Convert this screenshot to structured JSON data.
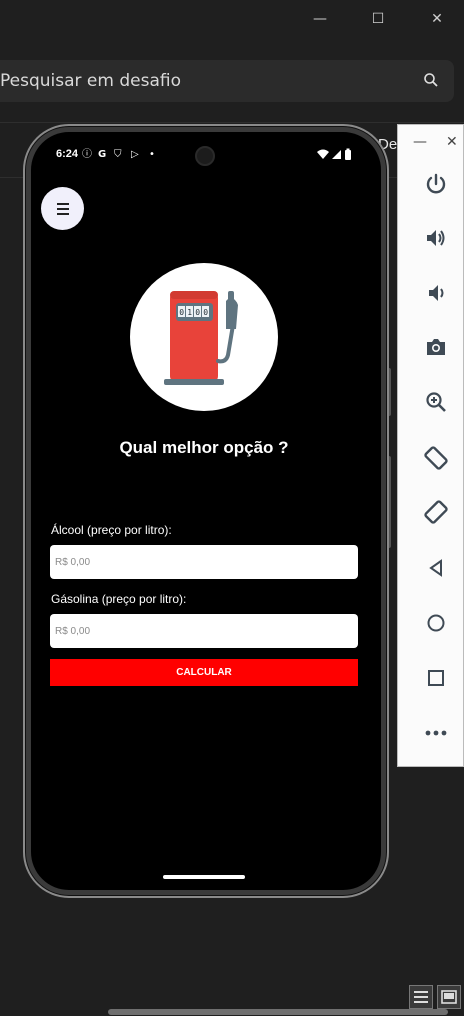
{
  "window": {
    "minimize_glyph": "—",
    "maximize_glyph": "☐",
    "close_glyph": "✕"
  },
  "search": {
    "text": "Pesquisar em desafio",
    "icon": "search-icon"
  },
  "ide": {
    "peek_text": "De"
  },
  "phone": {
    "status": {
      "time": "6:24",
      "left_icons": [
        "ⓘ",
        "G",
        "⛉",
        "▷",
        "•"
      ],
      "right_icons": [
        "wifi-icon",
        "signal-icon",
        "battery-icon"
      ]
    },
    "app": {
      "menu_icon": "hamburger-menu-icon",
      "logo_icon": "fuel-pump-icon",
      "pump_display": "0100",
      "title": "Qual melhor opção ?",
      "alcohol": {
        "label": "Álcool (preço por  litro):",
        "placeholder": "R$ 0,00"
      },
      "gasoline": {
        "label": "Gásolina (preço por  litro):",
        "placeholder": "R$ 0,00"
      },
      "button_label": "CALCULAR"
    },
    "colors": {
      "background": "#000000",
      "accent": "#ff0000",
      "pump": "#e8433a"
    }
  },
  "emulator": {
    "minimize_glyph": "—",
    "close_glyph": "✕",
    "buttons": [
      "power-icon",
      "volume-up-icon",
      "volume-down-icon",
      "camera-icon",
      "zoom-icon",
      "rotate-left-icon",
      "rotate-right-icon",
      "back-icon",
      "home-icon",
      "overview-icon",
      "more-icon"
    ]
  }
}
